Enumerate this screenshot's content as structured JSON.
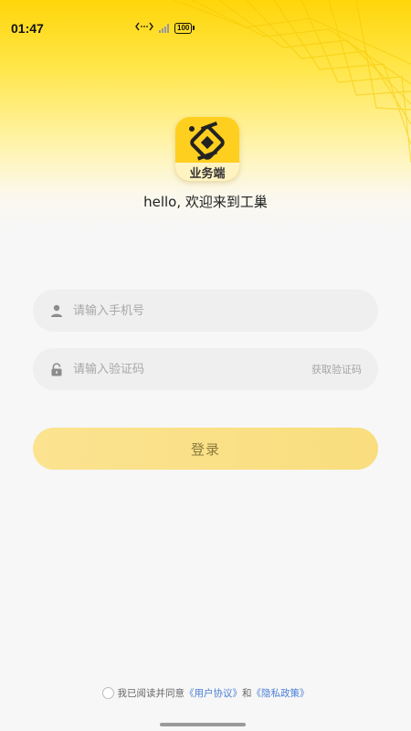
{
  "status_bar": {
    "time": "01:47",
    "battery": "100"
  },
  "app": {
    "logo_label": "业务端",
    "welcome": "hello, 欢迎来到工巢"
  },
  "form": {
    "phone_placeholder": "请输入手机号",
    "code_placeholder": "请输入验证码",
    "get_code_label": "获取验证码",
    "login_label": "登录"
  },
  "agreement": {
    "prefix": "我已阅读并同意",
    "user_agreement": "《用户协议》",
    "and": "和",
    "privacy_policy": "《隐私政策》"
  },
  "colors": {
    "brand_yellow": "#ffd60a",
    "button_bg": "#f9dd7e",
    "link": "#4a7fd6"
  }
}
